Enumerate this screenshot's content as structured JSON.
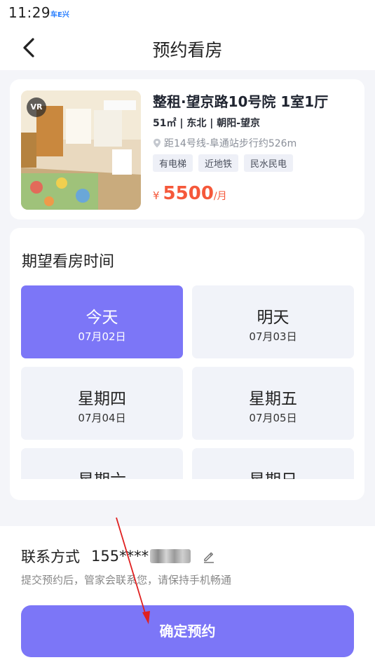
{
  "status_bar": {
    "time": "11:29",
    "app_label": "车E兴"
  },
  "nav": {
    "title": "预约看房"
  },
  "house": {
    "vr_badge": "VR",
    "title": "整租·望京路10号院 1室1厅",
    "meta": "51㎡ | 东北 | 朝阳-望京",
    "distance": "距14号线-阜通站步行约526m",
    "tags": [
      "有电梯",
      "近地铁",
      "民水民电"
    ],
    "price": {
      "currency": "¥",
      "amount": "5500",
      "unit": "/月"
    }
  },
  "schedule": {
    "title": "期望看房时间",
    "selected_index": 0,
    "days": [
      {
        "name": "今天",
        "date": "07月02日"
      },
      {
        "name": "明天",
        "date": "07月03日"
      },
      {
        "name": "星期四",
        "date": "07月04日"
      },
      {
        "name": "星期五",
        "date": "07月05日"
      },
      {
        "name": "星期六",
        "date": ""
      },
      {
        "name": "星期日",
        "date": ""
      }
    ]
  },
  "contact": {
    "label": "联系方式",
    "phone_visible": "155****",
    "hint": "提交预约后，管家会联系您，请保持手机畅通"
  },
  "confirm_button": {
    "label": "确定预约"
  },
  "colors": {
    "accent": "#7c76f7",
    "price": "#f5583a"
  }
}
